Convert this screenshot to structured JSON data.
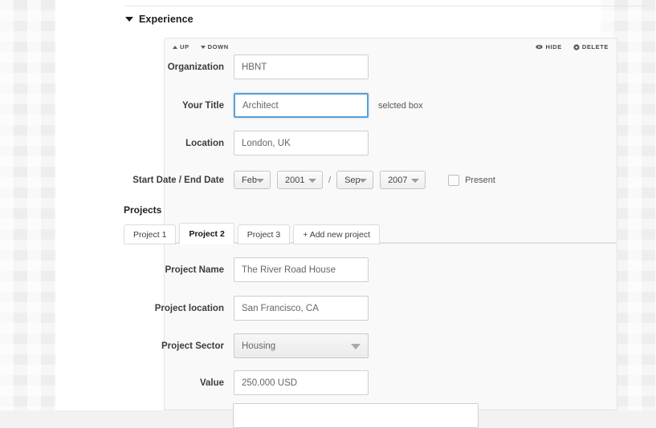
{
  "section": {
    "title": "Experience",
    "collapse_icon": "caret-down-icon"
  },
  "card_toolbar": {
    "up_label": "UP",
    "down_label": "DOWN",
    "hide_label": "HIDE",
    "delete_label": "DELETE",
    "up_icon": "triangle-up-icon",
    "down_icon": "triangle-down-icon",
    "hide_icon": "eye-icon",
    "delete_icon": "circle-dot-icon"
  },
  "experience_form": {
    "organization": {
      "label": "Organization",
      "value": "HBNT",
      "placeholder": "Organization"
    },
    "title": {
      "label": "Your Title",
      "value": "Architect",
      "placeholder": "Your Title",
      "annotation": "selcted box",
      "selected": true
    },
    "location": {
      "label": "Location",
      "value": "London, UK",
      "placeholder": "Location"
    },
    "dates": {
      "label": "Start Date / End Date",
      "start_month": "Feb",
      "start_year": "2001",
      "separator": "/",
      "end_month": "Sep",
      "end_year": "2007",
      "present_label": "Present",
      "present_checked": false
    }
  },
  "projects": {
    "title": "Projects",
    "tabs": [
      {
        "label": "Project 1",
        "active": false
      },
      {
        "label": "Project 2",
        "active": true
      },
      {
        "label": "Project 3",
        "active": false
      },
      {
        "label": "+ Add new project",
        "active": false
      }
    ]
  },
  "project_form": {
    "name": {
      "label": "Project Name",
      "value": "The River Road House",
      "placeholder": "Project Name"
    },
    "location": {
      "label": "Project location",
      "value": "San Francisco, CA",
      "placeholder": "Project location"
    },
    "sector": {
      "label": "Project Sector",
      "value": "Housing"
    },
    "value_field": {
      "label": "Value",
      "value": "250.000 USD",
      "placeholder": "Value"
    }
  },
  "colors": {
    "accent_selected": "#5a9fd4",
    "panel_bg": "#ffffff",
    "card_bg": "#f9f9f9",
    "border": "#e4e4e4"
  }
}
